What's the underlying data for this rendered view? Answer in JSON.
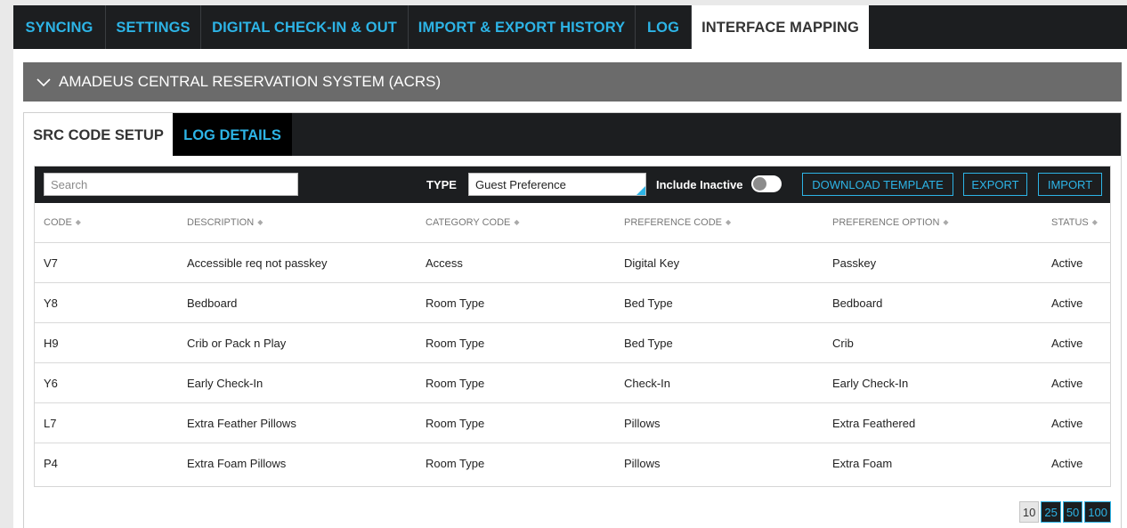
{
  "top_tabs": [
    "SYNCING",
    "SETTINGS",
    "DIGITAL CHECK-IN & OUT",
    "IMPORT & EXPORT HISTORY",
    "LOG",
    "INTERFACE MAPPING"
  ],
  "accordion": {
    "title": "AMADEUS CENTRAL RESERVATION SYSTEM (ACRS)",
    "icon": "chevron-down-icon"
  },
  "sub_tabs": [
    "SRC CODE SETUP",
    "LOG DETAILS"
  ],
  "toolbar": {
    "search_placeholder": "Search",
    "type_label": "TYPE",
    "type_value": "Guest Preference",
    "include_inactive_label": "Include Inactive",
    "include_inactive": false,
    "download_label": "DOWNLOAD TEMPLATE",
    "export_label": "EXPORT",
    "import_label": "IMPORT"
  },
  "table": {
    "columns": [
      "CODE",
      "DESCRIPTION",
      "CATEGORY CODE",
      "PREFERENCE CODE",
      "PREFERENCE OPTION",
      "STATUS"
    ],
    "rows": [
      [
        "V7",
        "Accessible req not passkey",
        "Access",
        "Digital Key",
        "Passkey",
        "Active"
      ],
      [
        "Y8",
        "Bedboard",
        "Room Type",
        "Bed Type",
        "Bedboard",
        "Active"
      ],
      [
        "H9",
        "Crib or Pack n Play",
        "Room Type",
        "Bed Type",
        "Crib",
        "Active"
      ],
      [
        "Y6",
        "Early Check-In",
        "Room Type",
        "Check-In",
        "Early Check-In",
        "Active"
      ],
      [
        "L7",
        "Extra Feather Pillows",
        "Room Type",
        "Pillows",
        "Extra Feathered",
        "Active"
      ],
      [
        "P4",
        "Extra Foam Pillows",
        "Room Type",
        "Pillows",
        "Extra Foam",
        "Active"
      ]
    ]
  },
  "pager": {
    "sizes": [
      "10",
      "25",
      "50",
      "100"
    ],
    "selected": "10"
  },
  "colors": {
    "accent": "#2db4e6",
    "dark": "#1c1e20",
    "accordion": "#6b6b6b"
  }
}
